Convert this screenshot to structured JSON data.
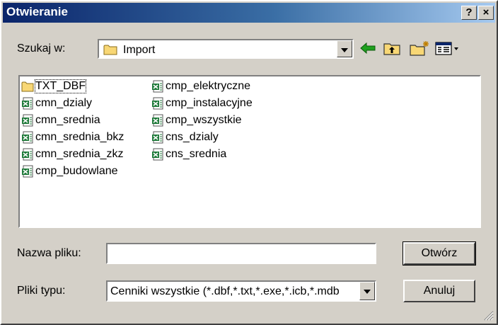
{
  "window": {
    "title": "Otwieranie",
    "help_label": "?",
    "close_label": "×"
  },
  "lookin": {
    "label": "Szukaj w:",
    "value": "Import"
  },
  "files": [
    {
      "name": "TXT_DBF",
      "type": "folder",
      "selected": true
    },
    {
      "name": "cmn_dzialy",
      "type": "excel"
    },
    {
      "name": "cmn_srednia",
      "type": "excel"
    },
    {
      "name": "cmn_srednia_bkz",
      "type": "excel"
    },
    {
      "name": "cmn_srednia_zkz",
      "type": "excel"
    },
    {
      "name": "cmp_budowlane",
      "type": "excel"
    },
    {
      "name": "cmp_elektryczne",
      "type": "excel"
    },
    {
      "name": "cmp_instalacyjne",
      "type": "excel"
    },
    {
      "name": "cmp_wszystkie",
      "type": "excel"
    },
    {
      "name": "cns_dzialy",
      "type": "excel"
    },
    {
      "name": "cns_srednia",
      "type": "excel"
    }
  ],
  "filename": {
    "label": "Nazwa pliku:",
    "value": ""
  },
  "filetype": {
    "label": "Pliki typu:",
    "value": "Cenniki wszystkie (*.dbf,*.txt,*.exe,*.icb,*.mdb"
  },
  "buttons": {
    "open": "Otwórz",
    "cancel": "Anuluj"
  },
  "icons": {
    "folder": "folder-icon",
    "excel": "excel-file-icon",
    "back": "back-arrow-icon",
    "up": "up-folder-icon",
    "newfolder": "new-folder-icon",
    "views": "view-menu-icon"
  },
  "colors": {
    "titlebar": "#0a246a",
    "face": "#d4d0c8",
    "folder": "#f8d775",
    "excel": "#1f7a3a"
  }
}
